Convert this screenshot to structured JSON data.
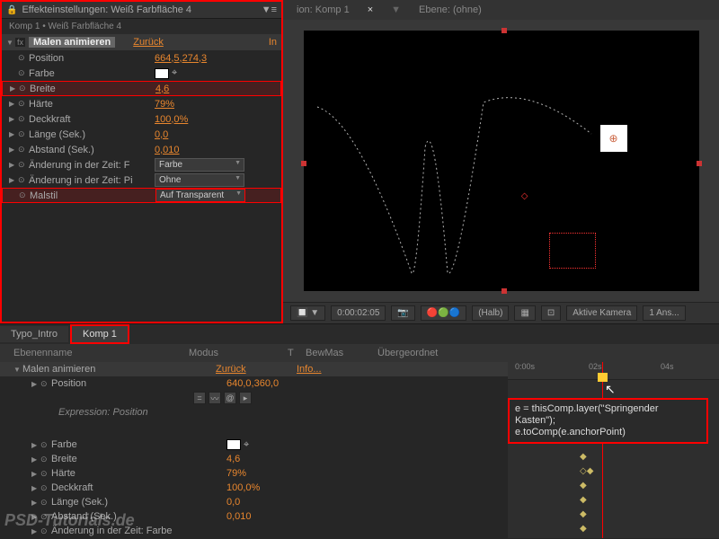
{
  "header": {
    "title": "Effekteinstellungen: Weiß Farbfläche 4",
    "breadcrumb": "Komp 1 • Weiß Farbfläche 4"
  },
  "effect": {
    "name": "Malen animieren",
    "reset": "Zurück",
    "info": "In"
  },
  "props": [
    {
      "name": "Position",
      "value": "664,5,274,3",
      "hl": false,
      "tri": false
    },
    {
      "name": "Farbe",
      "value": "",
      "hl": false,
      "tri": false,
      "swatch": true
    },
    {
      "name": "Breite",
      "value": "4,6",
      "hl": true,
      "tri": true
    },
    {
      "name": "Härte",
      "value": "79%",
      "hl": false,
      "tri": true
    },
    {
      "name": "Deckkraft",
      "value": "100,0%",
      "hl": false,
      "tri": true
    },
    {
      "name": "Länge (Sek.)",
      "value": "0,0",
      "hl": false,
      "tri": true
    },
    {
      "name": "Abstand (Sek.)",
      "value": "0,010",
      "hl": false,
      "tri": true
    },
    {
      "name": "Änderung in der Zeit: F",
      "value": "Farbe",
      "hl": false,
      "tri": true,
      "dd": true
    },
    {
      "name": "Änderung in der Zeit: Pi",
      "value": "Ohne",
      "hl": false,
      "tri": true,
      "dd": true
    },
    {
      "name": "Malstil",
      "value": "Auf Transparent",
      "hl": true,
      "tri": false,
      "dd": true
    }
  ],
  "viewer": {
    "tab1": "ion: Komp 1",
    "tab2": "Ebene: (ohne)",
    "timecode": "0:00:02:05",
    "quality": "(Halb)",
    "camera": "Aktive Kamera",
    "views": "1 Ans..."
  },
  "timeline": {
    "tab1": "Typo_Intro",
    "tab2": "Komp 1",
    "cols": {
      "name": "Ebenenname",
      "mode": "Modus",
      "t": "T",
      "mask": "BewMas",
      "parent": "Übergeordnet"
    },
    "layer": "Malen animieren",
    "reset": "Zurück",
    "info": "Info...",
    "rows": [
      {
        "name": "Position",
        "value": "640,0,360,0"
      },
      {
        "name": "Expression: Position",
        "value": "",
        "expr": true
      },
      {
        "name": "Farbe",
        "value": "",
        "swatch": true
      },
      {
        "name": "Breite",
        "value": "4,6"
      },
      {
        "name": "Härte",
        "value": "79%"
      },
      {
        "name": "Deckkraft",
        "value": "100,0%"
      },
      {
        "name": "Länge (Sek.)",
        "value": "0,0"
      },
      {
        "name": "Abstand (Sek.)",
        "value": "0,010"
      },
      {
        "name": "Änderung in der Zeit: Farbe",
        "value": ""
      }
    ],
    "ticks": [
      "0:00s",
      "02s",
      "04s"
    ],
    "expression": {
      "line1": "e = thisComp.layer(\"Springender Kasten\");",
      "line2": "e.toComp(e.anchorPoint)"
    }
  },
  "watermark": "PSD-Tutorials.de"
}
